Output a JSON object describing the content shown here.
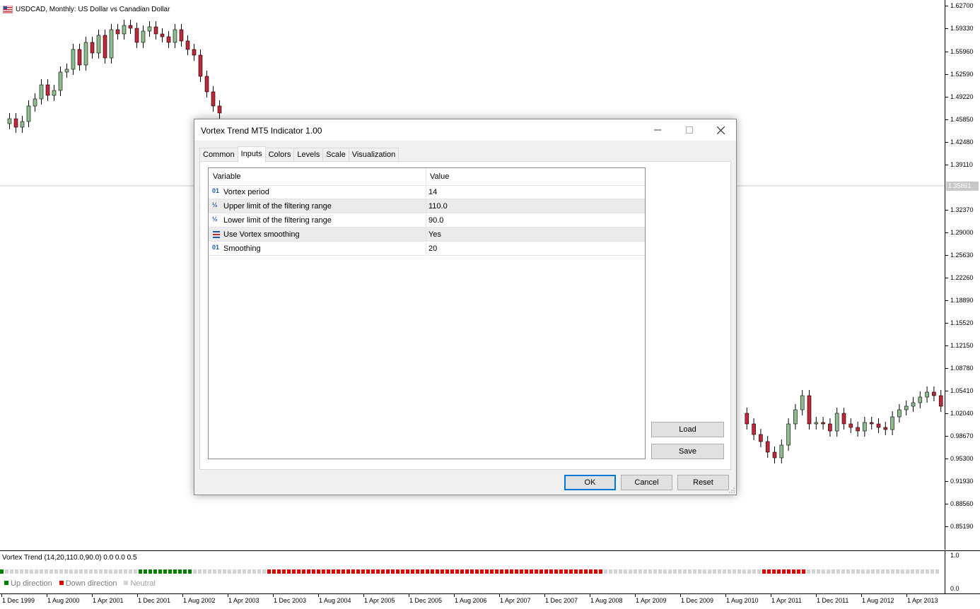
{
  "chart": {
    "title": "USDCAD, Monthly:  US Dollar vs Canadian Dollar",
    "flag_icon": "us-flag-icon",
    "price_labels": [
      "1.62700",
      "1.59330",
      "1.55960",
      "1.52590",
      "1.49220",
      "1.45850",
      "1.42480",
      "1.39110",
      "1.32370",
      "1.29000",
      "1.25630",
      "1.22260",
      "1.18890",
      "1.15520",
      "1.12150",
      "1.08780",
      "1.05410",
      "1.02040",
      "0.98670",
      "0.95300",
      "0.91930",
      "0.88560",
      "0.85190"
    ],
    "current_price": "1.35861",
    "colors": {
      "bull": "#8fbc8f",
      "bear": "#c0283a",
      "wick": "#000000",
      "outline": "#000000",
      "crosshair": "#c8c8c8"
    }
  },
  "indicator": {
    "title": "Vortex Trend (14,20,110.0,90.0) 0.0 0.0 0.5",
    "axis_top": "1.0",
    "axis_bottom": "0.0",
    "legend": [
      {
        "label": "Up direction",
        "color": "#008000"
      },
      {
        "label": "Down direction",
        "color": "#e00000"
      },
      {
        "label": "Neutral",
        "color": "#d3d3d3"
      }
    ],
    "segments": [
      {
        "state": "up",
        "count": 1
      },
      {
        "state": "neutral",
        "count": 27
      },
      {
        "state": "up",
        "count": 11
      },
      {
        "state": "neutral",
        "count": 15
      },
      {
        "state": "down",
        "count": 68
      },
      {
        "state": "neutral",
        "count": 32
      },
      {
        "state": "down",
        "count": 9
      },
      {
        "state": "neutral",
        "count": 27
      }
    ]
  },
  "time_axis": [
    "1 Dec 1999",
    "1 Aug 2000",
    "1 Apr 2001",
    "1 Dec 2001",
    "1 Aug 2002",
    "1 Apr 2003",
    "1 Dec 2003",
    "1 Aug 2004",
    "1 Apr 2005",
    "1 Dec 2005",
    "1 Aug 2006",
    "1 Apr 2007",
    "1 Dec 2007",
    "1 Aug 2008",
    "1 Apr 2009",
    "1 Dec 2009",
    "1 Aug 2010",
    "1 Apr 2011",
    "1 Dec 2011",
    "1 Aug 2012",
    "1 Apr 2013"
  ],
  "dialog": {
    "title": "Vortex Trend MT5 Indicator 1.00",
    "tabs": [
      "Common",
      "Inputs",
      "Colors",
      "Levels",
      "Scale",
      "Visualization"
    ],
    "active_tab": "Inputs",
    "grid_headers": {
      "variable": "Variable",
      "value": "Value"
    },
    "params": [
      {
        "icon": "integer-icon",
        "glyph": "01",
        "variable": "Vortex period",
        "value": "14"
      },
      {
        "icon": "fraction-icon",
        "glyph": "½",
        "variable": "Upper limit of the filtering range",
        "value": "110.0"
      },
      {
        "icon": "fraction-icon",
        "glyph": "½",
        "variable": "Lower limit of the filtering range",
        "value": "90.0"
      },
      {
        "icon": "boolean-icon",
        "glyph": "",
        "variable": "Use Vortex smoothing",
        "value": "Yes"
      },
      {
        "icon": "integer-icon",
        "glyph": "01",
        "variable": "Smoothing",
        "value": "20"
      }
    ],
    "buttons": {
      "load": "Load",
      "save": "Save",
      "ok": "OK",
      "cancel": "Cancel",
      "reset": "Reset"
    }
  }
}
